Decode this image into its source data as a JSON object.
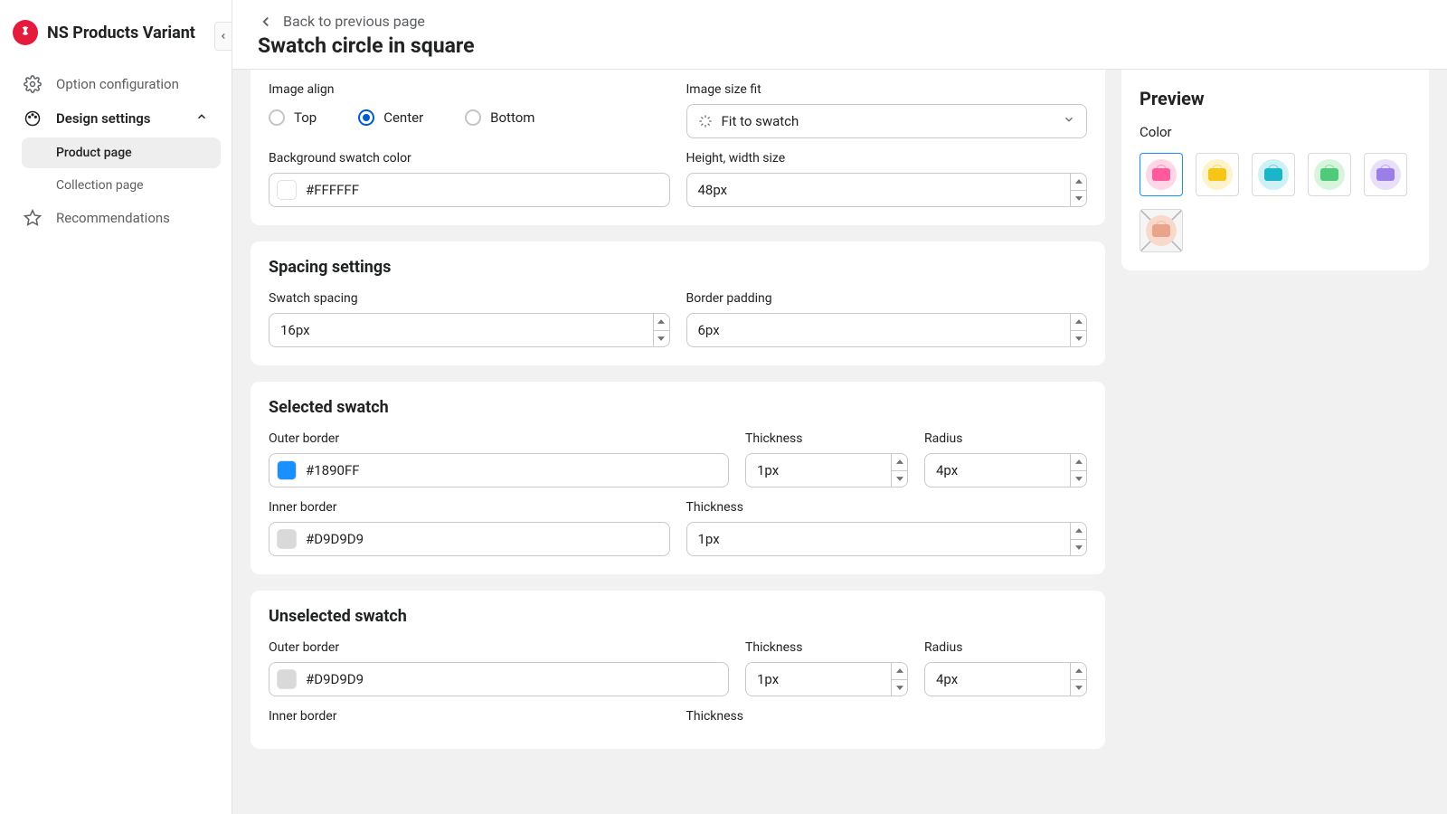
{
  "brand": "NS Products Variant",
  "sidebar": {
    "items": [
      {
        "label": "Option configuration"
      },
      {
        "label": "Design settings"
      },
      {
        "label": "Recommendations"
      }
    ],
    "design_sub": [
      {
        "label": "Product page"
      },
      {
        "label": "Collection page"
      }
    ]
  },
  "header": {
    "back": "Back to previous page",
    "title": "Swatch circle in square"
  },
  "image_align": {
    "label": "Image align",
    "options": [
      "Top",
      "Center",
      "Bottom"
    ],
    "selected": "Center"
  },
  "image_fit": {
    "label": "Image size fit",
    "value": "Fit to swatch"
  },
  "bg_color": {
    "label": "Background swatch color",
    "value": "#FFFFFF"
  },
  "size": {
    "label": "Height, width size",
    "value": "48px"
  },
  "spacing": {
    "title": "Spacing settings",
    "swatch": {
      "label": "Swatch spacing",
      "value": "16px"
    },
    "border": {
      "label": "Border padding",
      "value": "6px"
    }
  },
  "selected": {
    "title": "Selected swatch",
    "outer": {
      "label": "Outer border",
      "value": "#1890FF",
      "chip": "#1890FF"
    },
    "outer_thick": {
      "label": "Thickness",
      "value": "1px"
    },
    "outer_radius": {
      "label": "Radius",
      "value": "4px"
    },
    "inner": {
      "label": "Inner border",
      "value": "#D9D9D9",
      "chip": "#D9D9D9"
    },
    "inner_thick": {
      "label": "Thickness",
      "value": "1px"
    }
  },
  "unselected": {
    "title": "Unselected swatch",
    "outer": {
      "label": "Outer border",
      "value": "#D9D9D9",
      "chip": "#D9D9D9"
    },
    "outer_thick": {
      "label": "Thickness",
      "value": "1px"
    },
    "outer_radius": {
      "label": "Radius",
      "value": "4px"
    },
    "inner": {
      "label": "Inner border"
    },
    "inner_thick": {
      "label": "Thickness"
    }
  },
  "preview": {
    "title": "Preview",
    "label": "Color",
    "swatches": [
      {
        "bg": "#ffd6e6",
        "fg": "#ff5a9e",
        "selected": true
      },
      {
        "bg": "#fff3cc",
        "fg": "#f5c518"
      },
      {
        "bg": "#cdf1f5",
        "fg": "#1cb4c9"
      },
      {
        "bg": "#d7f4dd",
        "fg": "#4fc97a"
      },
      {
        "bg": "#e9dffb",
        "fg": "#9b7ee6"
      },
      {
        "bg": "#f8d9cc",
        "fg": "#e8a58b",
        "disabled": true
      }
    ]
  }
}
